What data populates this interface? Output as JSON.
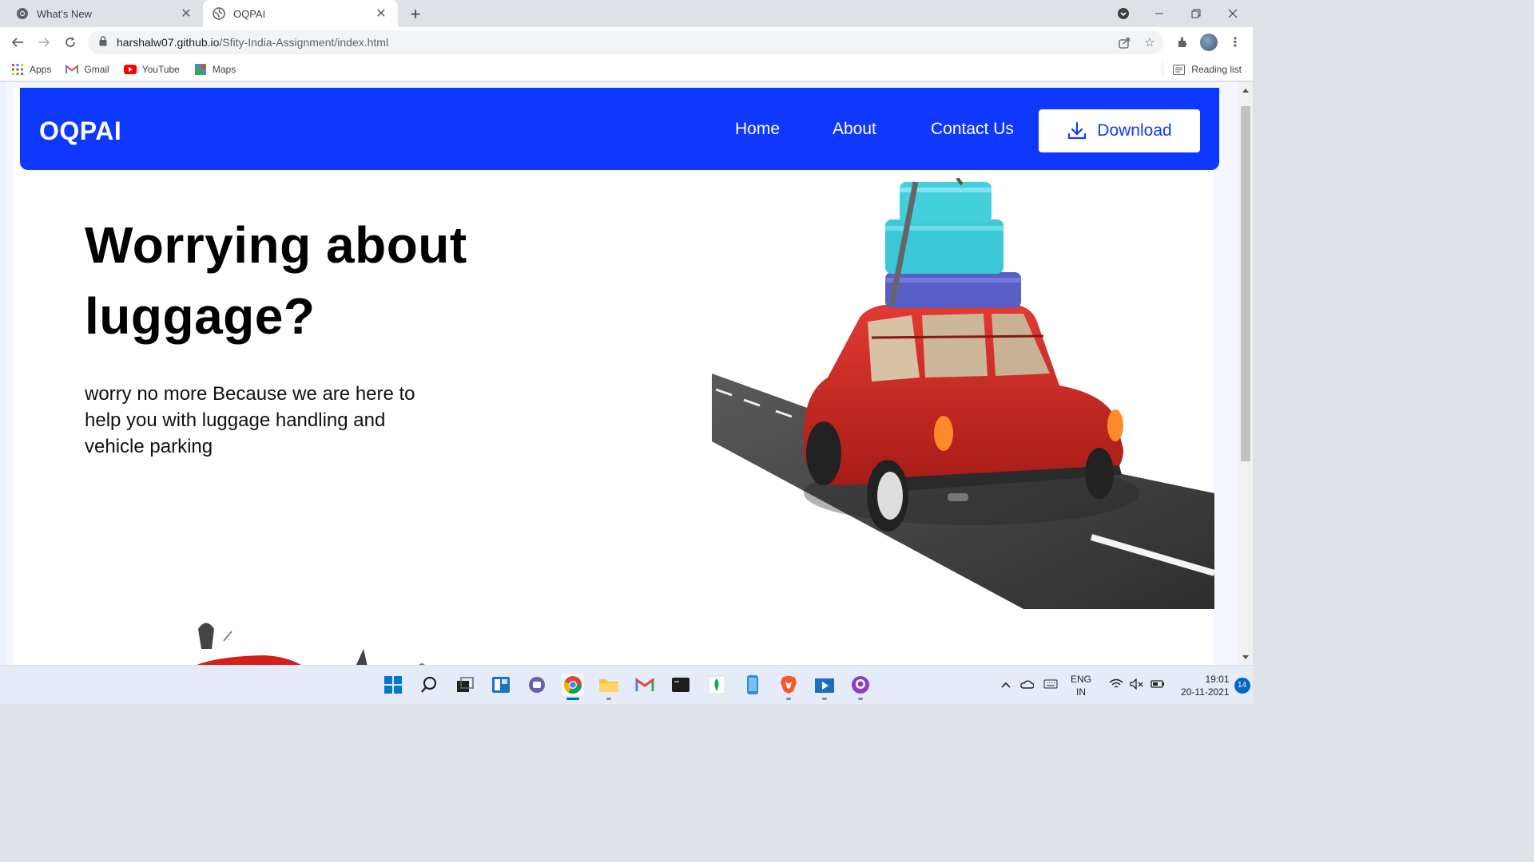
{
  "browser": {
    "tabs": [
      {
        "title": "What's New",
        "active": false
      },
      {
        "title": "OQPAI",
        "active": true
      }
    ],
    "new_tab_label": "+",
    "url_host": "harshalw07.github.io",
    "url_path": "/Sfity-India-Assignment/index.html",
    "bookmarks": [
      "Apps",
      "Gmail",
      "YouTube",
      "Maps"
    ],
    "reading_list": "Reading list"
  },
  "site": {
    "logo": "OQPAI",
    "nav": {
      "home": "Home",
      "about": "About",
      "contact": "Contact Us",
      "download": "Download"
    },
    "accent_color": "#0e38ff",
    "hero": {
      "title": "Worrying about luggage?",
      "subtitle": "worry no more Because we are here to help you with luggage handling and vehicle parking"
    }
  },
  "taskbar": {
    "language": "ENG",
    "region": "IN",
    "time": "19:01",
    "date": "20-11-2021",
    "notifications": "14"
  }
}
